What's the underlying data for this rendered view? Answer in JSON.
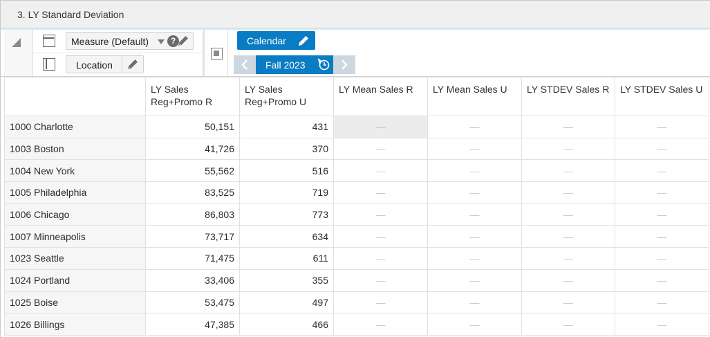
{
  "window": {
    "title": "3. LY Standard Deviation"
  },
  "pivot": {
    "rows_tile": {
      "label": "Measure (Default)",
      "icon": "dimension-rows-icon"
    },
    "cols_tile": {
      "label": "Location",
      "icon": "dimension-columns-icon"
    },
    "help_glyph": "?"
  },
  "calendar": {
    "dimension_label": "Calendar",
    "current_period": "Fall 2023"
  },
  "grid": {
    "columns": [
      "",
      "LY Sales\nReg+Promo R",
      "LY Sales\nReg+Promo U",
      "LY Mean Sales R",
      "LY Mean Sales U",
      "LY STDEV Sales R",
      "LY STDEV Sales U"
    ],
    "empty_marker": "—",
    "rows": [
      {
        "location": "1000 Charlotte",
        "sales_r": "50,151",
        "sales_u": "431"
      },
      {
        "location": "1003 Boston",
        "sales_r": "41,726",
        "sales_u": "370"
      },
      {
        "location": "1004 New York",
        "sales_r": "55,562",
        "sales_u": "516"
      },
      {
        "location": "1005 Philadelphia",
        "sales_r": "83,525",
        "sales_u": "719"
      },
      {
        "location": "1006 Chicago",
        "sales_r": "86,803",
        "sales_u": "773"
      },
      {
        "location": "1007 Minneapolis",
        "sales_r": "73,717",
        "sales_u": "634"
      },
      {
        "location": "1023 Seattle",
        "sales_r": "71,475",
        "sales_u": "611"
      },
      {
        "location": "1024 Portland",
        "sales_r": "33,406",
        "sales_u": "355"
      },
      {
        "location": "1025 Boise",
        "sales_r": "53,475",
        "sales_u": "497"
      },
      {
        "location": "1026 Billings",
        "sales_r": "47,385",
        "sales_u": "466"
      }
    ]
  },
  "colors": {
    "accent": "#0a7cc3",
    "nav_disabled": "#cdd7e0",
    "header_bg": "#f0f0f0"
  }
}
